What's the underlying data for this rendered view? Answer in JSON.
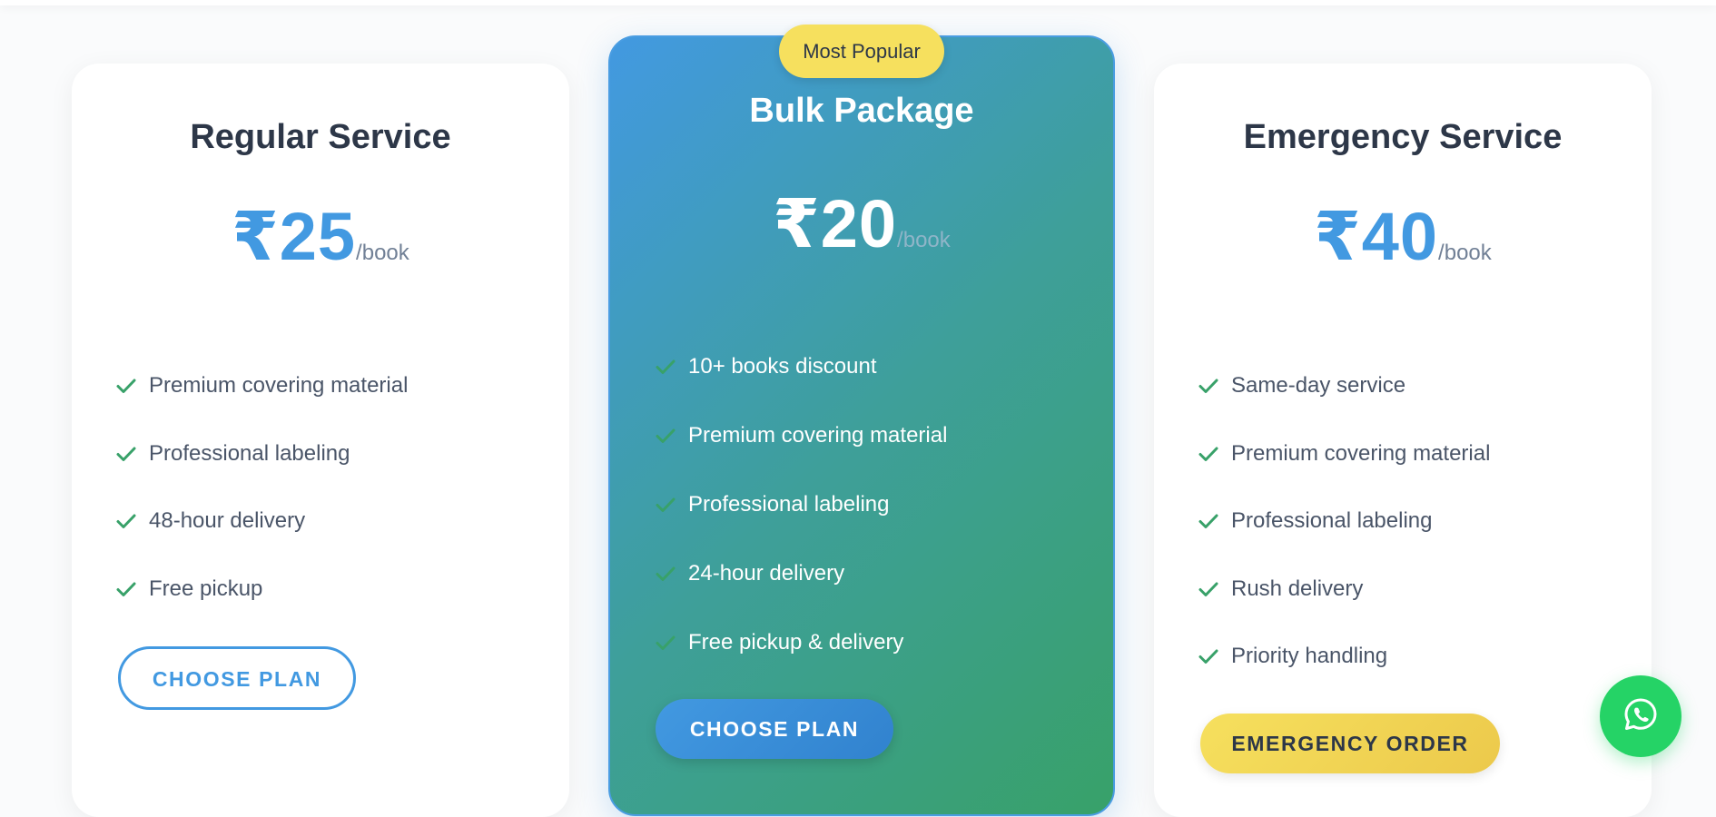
{
  "plans": {
    "regular": {
      "title": "Regular Service",
      "amount": "₹25",
      "per": "/book",
      "features": [
        "Premium covering material",
        "Professional labeling",
        "48-hour delivery",
        "Free pickup"
      ],
      "cta": "CHOOSE PLAN"
    },
    "bulk": {
      "badge": "Most Popular",
      "title": "Bulk Package",
      "amount": "₹20",
      "per": "/book",
      "features": [
        "10+ books discount",
        "Premium covering material",
        "Professional labeling",
        "24-hour delivery",
        "Free pickup & delivery"
      ],
      "cta": "CHOOSE PLAN"
    },
    "emergency": {
      "title": "Emergency Service",
      "amount": "₹40",
      "per": "/book",
      "features": [
        "Same-day service",
        "Premium covering material",
        "Professional labeling",
        "Rush delivery",
        "Priority handling"
      ],
      "cta": "EMERGENCY ORDER"
    }
  },
  "icons": {
    "feature": "check-icon",
    "floating": "whatsapp-icon"
  },
  "colors": {
    "accent": "#4299e1",
    "check": "#38a169",
    "badge": "#f6e05e",
    "whatsapp": "#25d366"
  }
}
